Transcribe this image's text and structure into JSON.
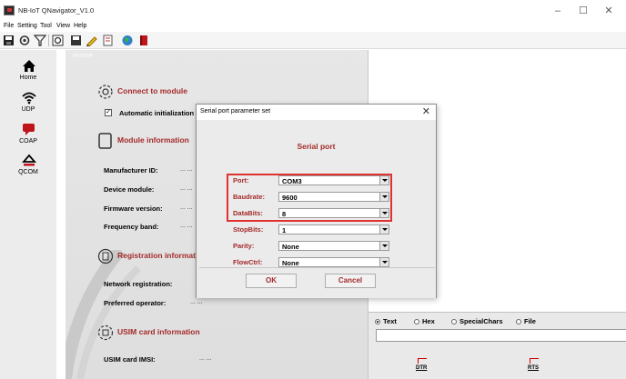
{
  "window": {
    "title": "NB-IoT QNavigator_V1.0",
    "controls": {
      "minimize": "–",
      "maximize": "☐",
      "close": "✕"
    }
  },
  "menu": {
    "items": [
      "File",
      "Setting",
      "Tool",
      "View",
      "Help"
    ]
  },
  "toolbar": {
    "icons": [
      "save-icon",
      "settings-icon",
      "filter-icon",
      "reload-icon",
      "disk-icon",
      "pencil-icon",
      "document-icon",
      "globe-icon",
      "book-icon"
    ]
  },
  "sidebar": {
    "items": [
      {
        "label": "Home",
        "icon": "home-icon"
      },
      {
        "label": "UDP",
        "icon": "wifi-icon"
      },
      {
        "label": "COAP",
        "icon": "chat-icon"
      },
      {
        "label": "QCOM",
        "icon": "eject-icon"
      }
    ]
  },
  "main": {
    "tab_label": "Home",
    "connect": {
      "title": "Connect to module",
      "auto_init_label": "Automatic initialization",
      "auto_init_checked": true
    },
    "module_info": {
      "title": "Module information",
      "fields": [
        {
          "label": "Manufacturer ID:",
          "value": "... ..."
        },
        {
          "label": "Device module:",
          "value": "... ..."
        },
        {
          "label": "Firmware version:",
          "value": "... ..."
        },
        {
          "label": "Frequency band:",
          "value": "... ..."
        }
      ]
    },
    "registration": {
      "title": "Registration informati",
      "fields": [
        {
          "label": "Network registration:",
          "value": "... ..."
        },
        {
          "label": "Preferred operator:",
          "value": "... ..."
        }
      ]
    },
    "usim": {
      "title": "USIM card information",
      "fields": [
        {
          "label": "USIM card IMSI:",
          "value": "... ..."
        }
      ]
    }
  },
  "send_panel": {
    "modes": [
      {
        "label": "Text",
        "selected": true
      },
      {
        "label": "Hex",
        "selected": false
      },
      {
        "label": "SpecialChars",
        "selected": false
      },
      {
        "label": "File",
        "selected": false
      }
    ],
    "input_value": "",
    "signals": [
      "DTR",
      "RTS"
    ]
  },
  "dialog": {
    "title": "Serial port parameter set",
    "close": "✕",
    "heading": "Serial port",
    "fields": [
      {
        "label": "Port:",
        "value": "COM3"
      },
      {
        "label": "Baudrate:",
        "value": "9600"
      },
      {
        "label": "DataBits:",
        "value": "8"
      },
      {
        "label": "StopBits:",
        "value": "1"
      },
      {
        "label": "Parity:",
        "value": "None"
      },
      {
        "label": "FlowCtrl:",
        "value": "None"
      }
    ],
    "ok_label": "OK",
    "cancel_label": "Cancel"
  },
  "colors": {
    "accent_text": "#a52a2a",
    "highlight_border": "#e03030",
    "icon_red": "#c0141c"
  }
}
